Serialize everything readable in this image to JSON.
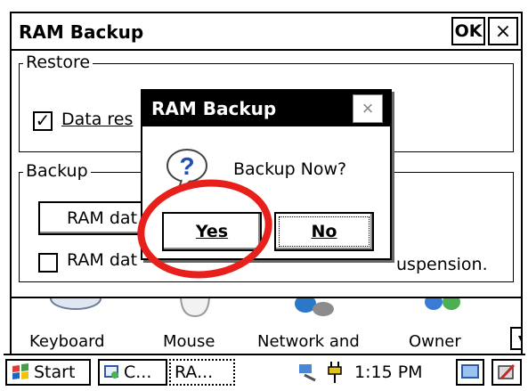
{
  "window": {
    "title": "RAM Backup",
    "ok_label": "OK",
    "close_label": "×"
  },
  "restore_group": {
    "legend": "Restore",
    "checkbox_label": "Data res",
    "checkbox_checked": true,
    "checkbox_glyph": "✓"
  },
  "backup_group": {
    "legend": "Backup",
    "ram_data_button": "RAM dat",
    "checkbox_label": "RAM dat",
    "checkbox_checked": false,
    "suspension_text": "uspension."
  },
  "dialog": {
    "title": "RAM Backup",
    "close_label": "×",
    "message": "Backup Now?",
    "icon": "question-icon",
    "yes_label": "Yes",
    "no_label": "No"
  },
  "control_panel": {
    "items": [
      {
        "label": "Keyboard",
        "icon": "keyboard-icon"
      },
      {
        "label": "Mouse",
        "icon": "mouse-icon"
      },
      {
        "label": "Network and",
        "icon": "network-icon"
      },
      {
        "label": "Owner",
        "icon": "owner-icon"
      }
    ],
    "scroll_glyph": "▼"
  },
  "taskbar": {
    "start_label": "Start",
    "task1_label": "C...",
    "task2_label": "RA...",
    "clock": "1:15 PM"
  },
  "colors": {
    "annotation": "#e8201c",
    "dialog_titlebar": "#000000",
    "question_icon_blue": "#1f4fb5"
  }
}
